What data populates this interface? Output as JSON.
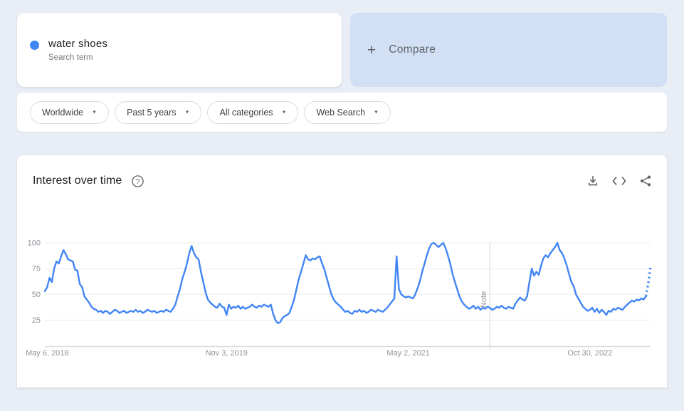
{
  "colors": {
    "page_bg": "#e9edf6",
    "card_bg": "#ffffff",
    "compare_bg": "#d2e0f5",
    "accent_blue": "#4285f4",
    "text_primary": "#202124",
    "text_secondary": "#5f6368",
    "axis_label": "#8f949a",
    "grid_line": "#ebedef",
    "axis_line": "#dadce0",
    "note_line": "#d2d5d9"
  },
  "search_card": {
    "term": "water shoes",
    "subtitle": "Search term"
  },
  "compare_card": {
    "plus_symbol": "+",
    "label": "Compare"
  },
  "filters": [
    {
      "label": "Worldwide"
    },
    {
      "label": "Past 5 years"
    },
    {
      "label": "All categories"
    },
    {
      "label": "Web Search"
    }
  ],
  "chart_section": {
    "title": "Interest over time",
    "help_icon": "?",
    "actions": [
      "download-icon",
      "embed-icon",
      "share-icon"
    ]
  },
  "chart_data": {
    "type": "line",
    "title": "Interest over time",
    "series_name": "water shoes",
    "line_color": "#4285f4",
    "grid": true,
    "ylim": [
      0,
      100
    ],
    "y_ticks": [
      25,
      50,
      75,
      100
    ],
    "x_weeks_total": 260,
    "x_ticks": [
      {
        "label": "May 6, 2018",
        "week": 0
      },
      {
        "label": "Nov 3, 2019",
        "week": 78
      },
      {
        "label": "May 2, 2021",
        "week": 156
      },
      {
        "label": "Oct 30, 2022",
        "week": 234
      }
    ],
    "note_annotation": {
      "label": "Note",
      "week": 191
    },
    "dotted_from_index": 258,
    "values": [
      53,
      57,
      66,
      62,
      75,
      82,
      80,
      87,
      93,
      89,
      84,
      83,
      82,
      74,
      73,
      60,
      57,
      48,
      45,
      42,
      38,
      36,
      35,
      33,
      34,
      32,
      34,
      33,
      31,
      33,
      35,
      34,
      32,
      33,
      34,
      32,
      33,
      34,
      33,
      35,
      33,
      34,
      32,
      33,
      35,
      34,
      33,
      34,
      32,
      33,
      34,
      33,
      35,
      34,
      33,
      36,
      40,
      48,
      55,
      65,
      72,
      80,
      90,
      97,
      90,
      86,
      84,
      72,
      62,
      52,
      45,
      42,
      40,
      38,
      37,
      41,
      38,
      37,
      30,
      40,
      36,
      38,
      37,
      39,
      36,
      38,
      36,
      37,
      38,
      40,
      38,
      37,
      39,
      38,
      40,
      39,
      38,
      40,
      31,
      25,
      22,
      23,
      27,
      29,
      30,
      32,
      38,
      45,
      55,
      65,
      72,
      80,
      88,
      84,
      83,
      85,
      84,
      86,
      87,
      80,
      74,
      66,
      58,
      50,
      45,
      42,
      40,
      38,
      35,
      33,
      34,
      32,
      31,
      34,
      33,
      35,
      33,
      34,
      32,
      33,
      35,
      34,
      33,
      35,
      34,
      33,
      35,
      37,
      40,
      43,
      46,
      87,
      55,
      50,
      48,
      47,
      48,
      47,
      46,
      50,
      56,
      63,
      72,
      80,
      88,
      95,
      99,
      100,
      98,
      96,
      98,
      100,
      95,
      88,
      80,
      70,
      62,
      55,
      48,
      43,
      40,
      38,
      36,
      37,
      39,
      36,
      38,
      35,
      37,
      36,
      38,
      37,
      35,
      36,
      38,
      37,
      39,
      37,
      36,
      38,
      37,
      36,
      41,
      44,
      47,
      45,
      44,
      48,
      62,
      75,
      68,
      72,
      69,
      78,
      85,
      88,
      86,
      90,
      93,
      96,
      100,
      93,
      90,
      85,
      78,
      70,
      62,
      58,
      50,
      46,
      42,
      38,
      36,
      34,
      35,
      37,
      33,
      36,
      32,
      35,
      33,
      30,
      34,
      33,
      36,
      35,
      37,
      36,
      35,
      38,
      40,
      42,
      44,
      43,
      45,
      44,
      46,
      45,
      48,
      60,
      77
    ]
  }
}
